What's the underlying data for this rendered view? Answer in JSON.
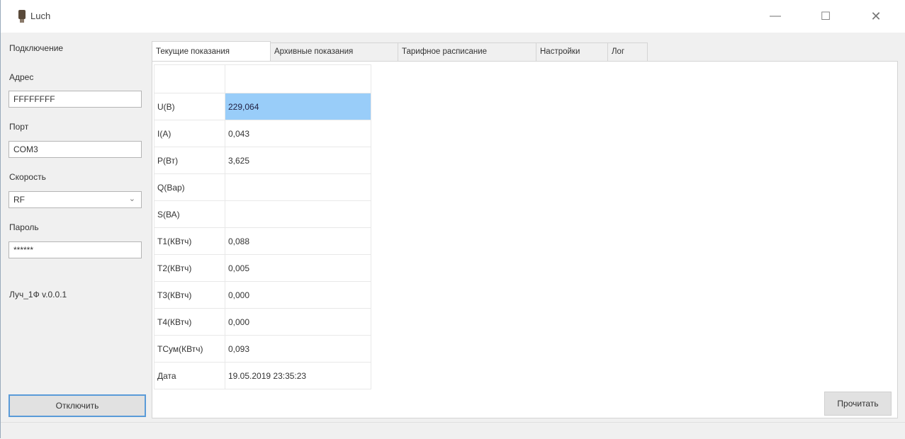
{
  "window": {
    "title": "Luch",
    "minimize": "—",
    "maximize": "☐",
    "close": "✕"
  },
  "sidebar": {
    "group_label": "Подключение",
    "address_label": "Адрес",
    "address_value": "FFFFFFFF",
    "port_label": "Порт",
    "port_value": "COM3",
    "speed_label": "Скорость",
    "speed_value": "RF",
    "password_label": "Пароль",
    "password_value": "******",
    "version": "Луч_1Ф v.0.0.1",
    "disconnect_label": "Отключить"
  },
  "tabs": [
    {
      "label": "Текущие показания",
      "active": true
    },
    {
      "label": "Архивные показания",
      "active": false
    },
    {
      "label": "Тарифное расписание",
      "active": false
    },
    {
      "label": "Настройки",
      "active": false
    },
    {
      "label": "Лог",
      "active": false
    }
  ],
  "readings": [
    {
      "name": "U(В)",
      "value": "229,064"
    },
    {
      "name": "I(А)",
      "value": "0,043"
    },
    {
      "name": "P(Вт)",
      "value": "3,625"
    },
    {
      "name": "Q(Вар)",
      "value": ""
    },
    {
      "name": "S(ВА)",
      "value": ""
    },
    {
      "name": "T1(КВтч)",
      "value": "0,088"
    },
    {
      "name": "T2(КВтч)",
      "value": "0,005"
    },
    {
      "name": "T3(КВтч)",
      "value": "0,000"
    },
    {
      "name": "T4(КВтч)",
      "value": "0,000"
    },
    {
      "name": "TСум(КВтч)",
      "value": "0,093"
    },
    {
      "name": "Дата",
      "value": "19.05.2019 23:35:23"
    }
  ],
  "read_button": "Прочитать",
  "colors": {
    "selection": "#99cdf9",
    "focus_border": "#5a9bd8"
  }
}
